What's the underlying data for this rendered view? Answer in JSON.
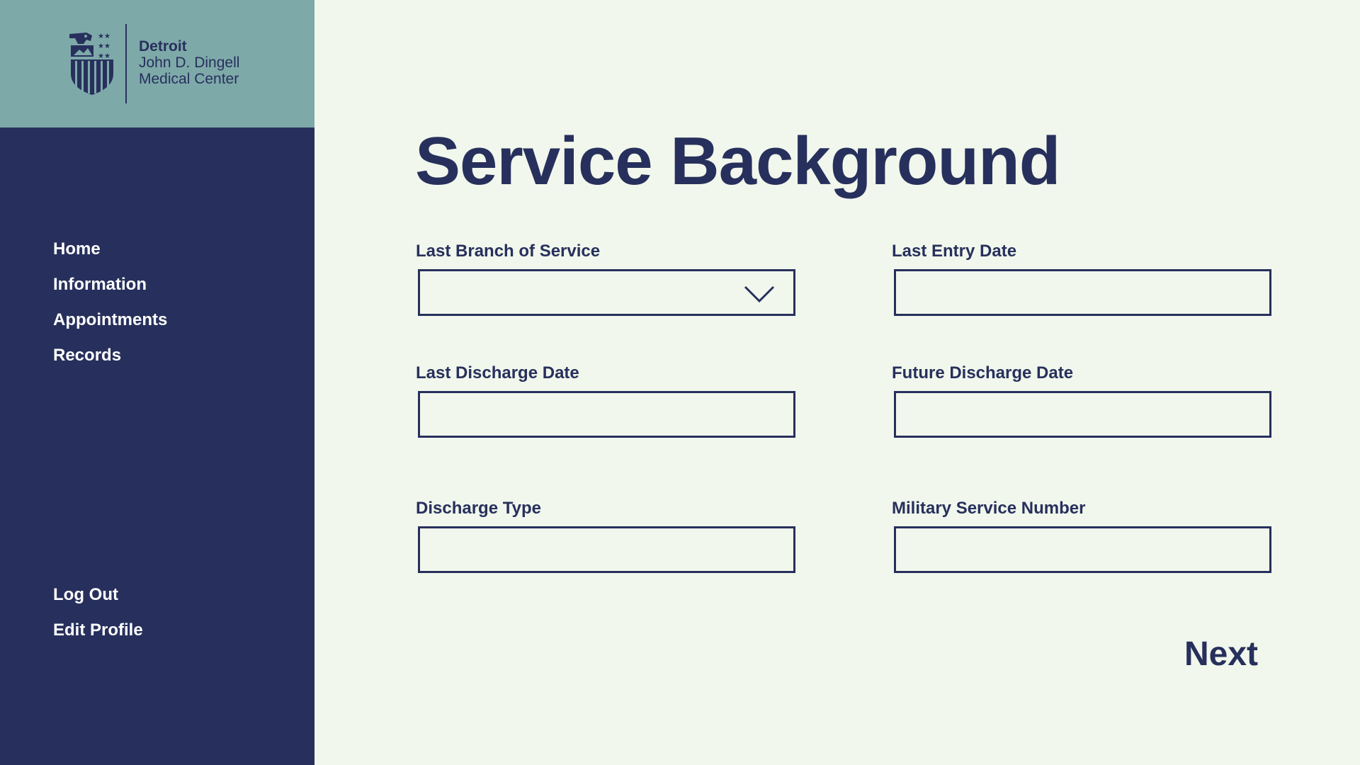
{
  "brand": {
    "line1": "Detroit",
    "line2": "John D. Dingell",
    "line3": "Medical Center",
    "logo_icon": "eagle-shield-icon"
  },
  "nav": {
    "items": [
      {
        "label": "Home"
      },
      {
        "label": "Information"
      },
      {
        "label": "Appointments"
      },
      {
        "label": "Records"
      }
    ],
    "bottom": [
      {
        "label": "Log Out"
      },
      {
        "label": "Edit Profile"
      }
    ]
  },
  "page": {
    "title": "Service Background"
  },
  "form": {
    "last_branch": {
      "label": "Last Branch of Service",
      "value": ""
    },
    "last_entry_date": {
      "label": "Last Entry Date",
      "value": ""
    },
    "last_discharge_date": {
      "label": "Last Discharge Date",
      "value": ""
    },
    "future_discharge_date": {
      "label": "Future Discharge Date",
      "value": ""
    },
    "discharge_type": {
      "label": "Discharge Type",
      "value": ""
    },
    "military_service_number": {
      "label": "Military Service Number",
      "value": ""
    }
  },
  "actions": {
    "next_label": "Next"
  },
  "colors": {
    "navy": "#27305c",
    "teal": "#7ea9a9",
    "background": "#f1f7ec",
    "white": "#ffffff"
  }
}
